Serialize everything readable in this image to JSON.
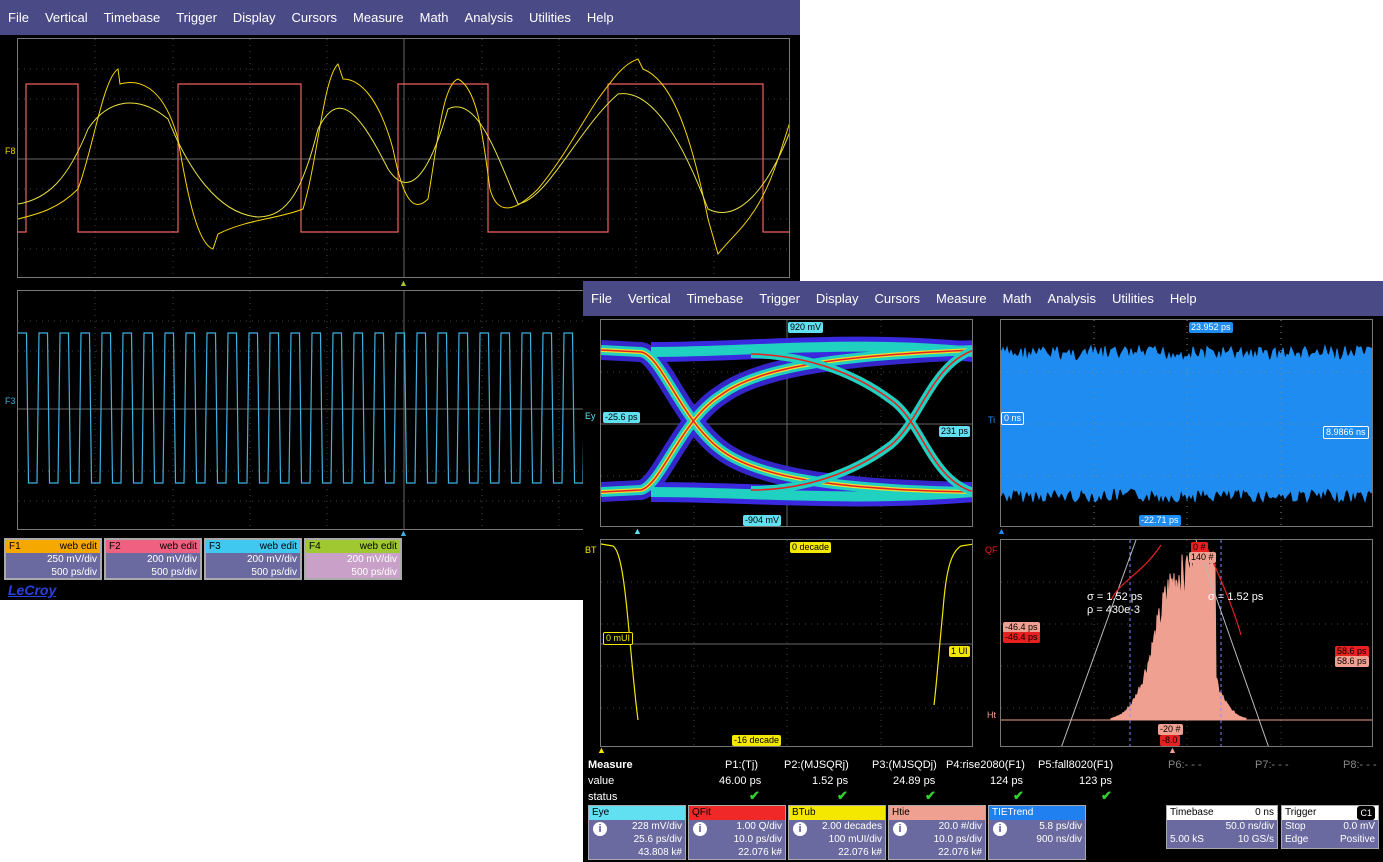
{
  "menu": [
    "File",
    "Vertical",
    "Timebase",
    "Trigger",
    "Display",
    "Cursors",
    "Measure",
    "Math",
    "Analysis",
    "Utilities",
    "Help"
  ],
  "colors": {
    "f1": "#f5d400",
    "f2": "#f06060",
    "f3": "#40b0e0",
    "f4": "#a0c830",
    "bg": "#000000",
    "menubar": "#4a4a86"
  },
  "trace_labels": {
    "f8": "F8",
    "f3": "F3",
    "ey": "Ey",
    "ti": "Ti",
    "bt": "BT",
    "qf": "QF",
    "ht": "Ht"
  },
  "channels": [
    {
      "name": "F1",
      "edit": "web edit",
      "vdiv": "250 mV/div",
      "tdiv": "500 ps/div",
      "color": "#f5a800"
    },
    {
      "name": "F2",
      "edit": "web edit",
      "vdiv": "200 mV/div",
      "tdiv": "500 ps/div",
      "color": "#f06080"
    },
    {
      "name": "F3",
      "edit": "web edit",
      "vdiv": "200 mV/div",
      "tdiv": "500 ps/div",
      "color": "#40c8f0"
    },
    {
      "name": "F4",
      "edit": "web edit",
      "vdiv": "200 mV/div",
      "tdiv": "500 ps/div",
      "color": "#a0c830"
    }
  ],
  "brand": "LeCroy",
  "eye_tags": {
    "top": "920 mV",
    "left": "-25.6 ps",
    "right": "231 ps",
    "bottom": "-904 mV"
  },
  "tie_tags": {
    "top": "23.952 ps",
    "left": "0 ns",
    "right": "8.9866 ns",
    "bottom": "-22.71 ps"
  },
  "bathtub_tags": {
    "top": "0 decade",
    "left": "0 mUI",
    "right": "1 UI",
    "bottom": "-16 decade"
  },
  "qfit_tags": {
    "top1": "0 #",
    "top2": "140 #",
    "left1": "-46.4 ps",
    "left2": "-46.4 ps",
    "right1": "58.6 ps",
    "right2": "58.6 ps",
    "bot1": "-20 #",
    "bot2": "-8.0",
    "sigma_left": "σ = 1.52 ps",
    "rho": "ρ = 430e-3",
    "sigma_right": "σ = 1.52 ps"
  },
  "measure": {
    "title": "Measure",
    "row_value": "value",
    "row_status": "status",
    "params": [
      {
        "name": "P1:(Tj)",
        "value": "46.00 ps",
        "ok": true
      },
      {
        "name": "P2:(MJSQRj)",
        "value": "1.52 ps",
        "ok": true
      },
      {
        "name": "P3:(MJSQDj)",
        "value": "24.89 ps",
        "ok": true
      },
      {
        "name": "P4:rise2080(F1)",
        "value": "124 ps",
        "ok": true
      },
      {
        "name": "P5:fall8020(F1)",
        "value": "123 ps",
        "ok": true
      },
      {
        "name": "P6:- - -",
        "value": "",
        "ok": false
      },
      {
        "name": "P7:- - -",
        "value": "",
        "ok": false
      },
      {
        "name": "P8:- - -",
        "value": "",
        "ok": false
      }
    ],
    "check": "✔"
  },
  "traces": [
    {
      "name": "Eye",
      "color": "#60e0f0",
      "l1": "228 mV/div",
      "l2": "25.6 ps/div",
      "l3": "43.808 k#"
    },
    {
      "name": "QFit",
      "color": "#f02828",
      "l1": "1.00 Q/div",
      "l2": "10.0 ps/div",
      "l3": "22.076 k#"
    },
    {
      "name": "BTub",
      "color": "#f5e800",
      "l1": "2.00 decades",
      "l2": "100 mUI/div",
      "l3": "22.076 k#"
    },
    {
      "name": "Htie",
      "color": "#f0a090",
      "l1": "20.0 #/div",
      "l2": "10.0 ps/div",
      "l3": "22.076 k#"
    },
    {
      "name": "TIETrend",
      "color": "#2080f0",
      "l1": "5.8 ps/div",
      "l2": "900 ns/div",
      "l3": ""
    }
  ],
  "timebase": {
    "title": "Timebase",
    "offset": "0 ns",
    "tdiv": "50.0 ns/div",
    "samples": "5.00 kS",
    "rate": "10 GS/s"
  },
  "trigger": {
    "title": "Trigger",
    "src": "C1",
    "mode": "Stop",
    "level": "0.0 mV",
    "type": "Edge",
    "slope": "Positive"
  }
}
